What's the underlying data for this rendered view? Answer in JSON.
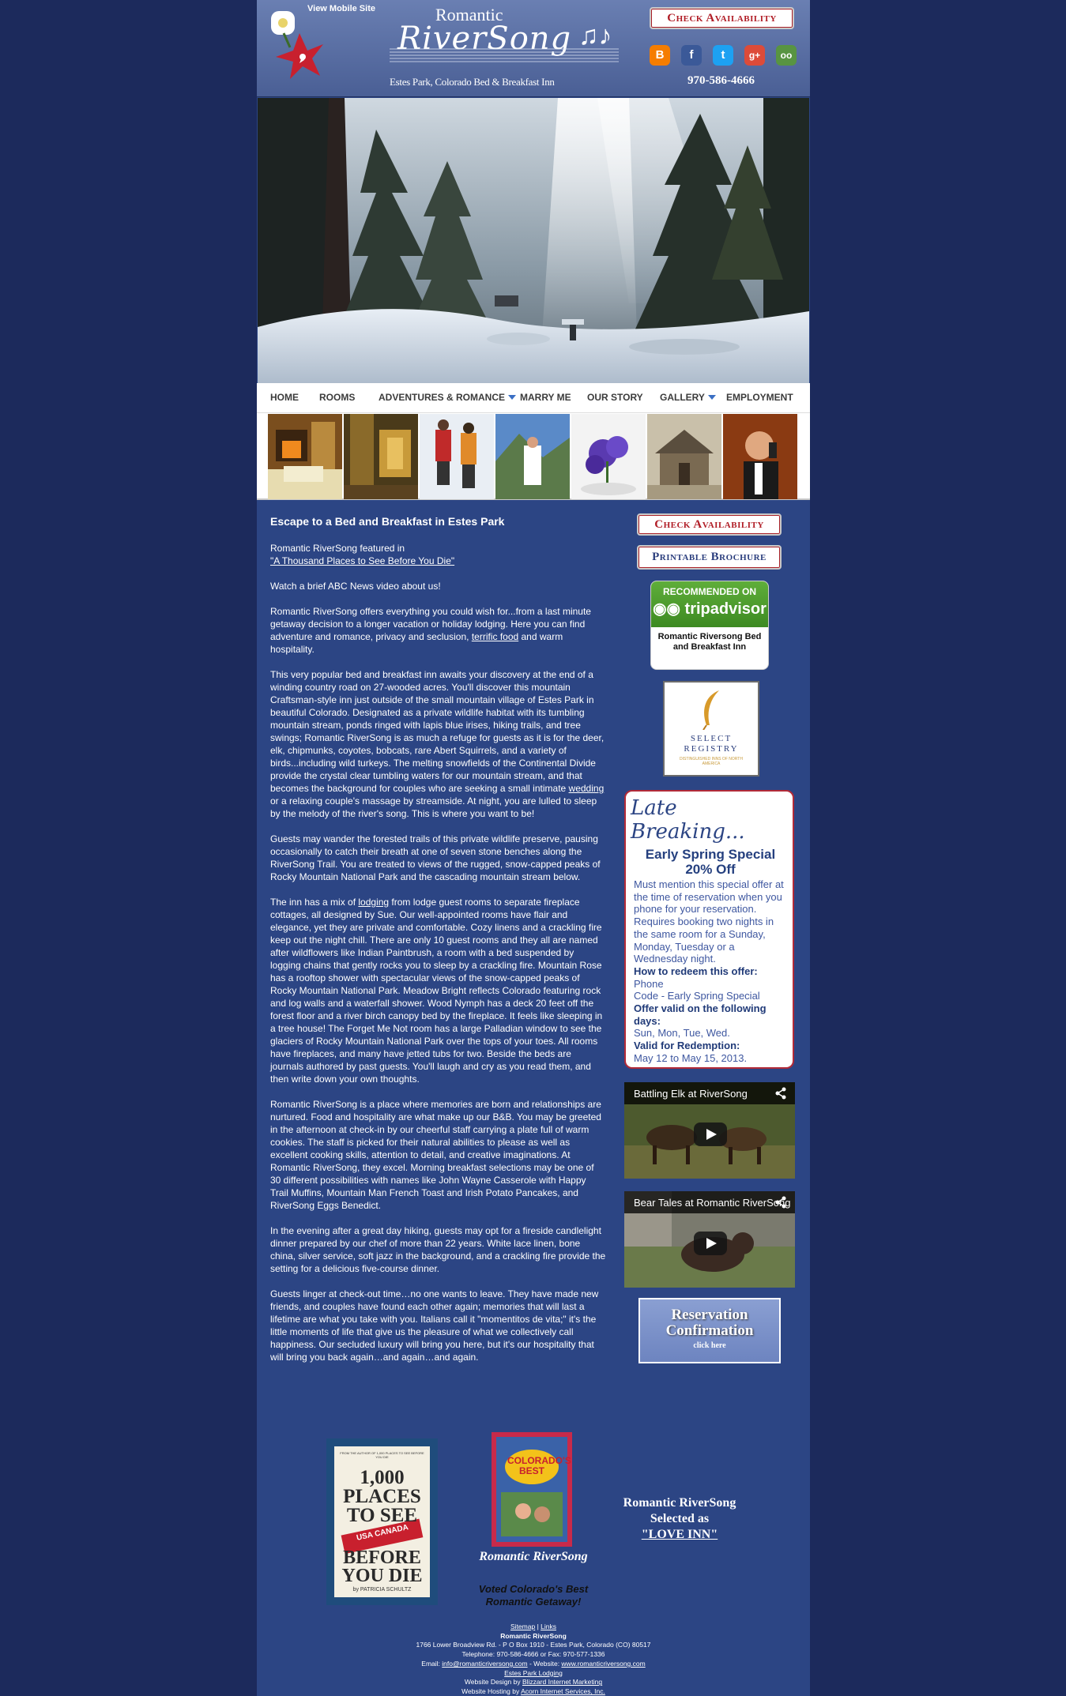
{
  "header": {
    "mobile_link": "View Mobile Site",
    "logo_top": "Romantic",
    "logo_main": "RiverSong",
    "logo_sub": "Estes Park, Colorado Bed & Breakfast Inn",
    "check_availability": "Check Availability",
    "phone": "970-586-4666",
    "socials": [
      {
        "icon": "blogger-icon",
        "glyph": "B",
        "color": "#f57d00"
      },
      {
        "icon": "facebook-icon",
        "glyph": "f",
        "color": "#3b5998"
      },
      {
        "icon": "twitter-icon",
        "glyph": "t",
        "color": "#1da1f2"
      },
      {
        "icon": "google-plus-icon",
        "glyph": "g+",
        "color": "#dd4b39"
      },
      {
        "icon": "tripadvisor-icon",
        "glyph": "oo",
        "color": "#589442"
      }
    ]
  },
  "nav": {
    "home": "HOME",
    "rooms": "ROOMS",
    "adventures": "ADVENTURES & ROMANCE",
    "marry": "MARRY ME",
    "story": "OUR STORY",
    "gallery": "GALLERY",
    "employment": "EMPLOYMENT"
  },
  "main": {
    "heading": "Escape to a Bed and Breakfast in Estes Park",
    "featured_intro": "Romantic RiverSong featured in",
    "featured_link": "\"A Thousand Places to See Before You Die\"",
    "watch_video": "Watch a brief ABC News video about us!",
    "p1_a": "Romantic RiverSong offers everything you could wish for...from a last minute getaway decision to a longer vacation or holiday lodging.  Here you can find adventure and romance, privacy and seclusion, ",
    "p1_link": "terrific food",
    "p1_b": " and warm hospitality.",
    "p2_a": "This very popular bed and breakfast inn awaits your discovery at the end of a winding country road on 27-wooded acres. You'll discover this mountain Craftsman-style inn just outside of the small mountain village of Estes Park in beautiful Colorado. Designated as a private wildlife habitat with its tumbling mountain stream, ponds ringed with lapis blue irises, hiking trails, and tree swings; Romantic RiverSong is as much a refuge for guests as it is for the deer, elk, chipmunks, coyotes, bobcats, rare Abert Squirrels, and a variety of birds...including wild turkeys. The melting snowfields of the Continental Divide provide the crystal clear tumbling waters for our mountain stream, and that becomes the background for couples who are seeking a small intimate ",
    "p2_link": "wedding",
    "p2_b": " or a relaxing couple's massage by streamside. At night, you are lulled to sleep by the melody of the river's song. This is where you want to be!",
    "p3": "Guests may wander the forested trails of this private wildlife preserve, pausing occasionally to catch their breath at one of seven stone benches along the RiverSong Trail. You are treated to views of the rugged, snow-capped peaks of Rocky Mountain National Park and the cascading mountain stream below.",
    "p4_a": "The inn has a mix of ",
    "p4_link": "lodging",
    "p4_b": " from lodge guest rooms to separate fireplace cottages, all designed by Sue. Our well-appointed rooms have flair and elegance, yet they are private and comfortable. Cozy linens and a crackling fire keep out the night chill. There are only 10 guest rooms and they all are named after wildflowers like Indian Paintbrush, a room with a bed suspended by logging chains that gently rocks you to sleep by a crackling fire. Mountain Rose has a rooftop shower with spectacular views of the snow-capped peaks of Rocky Mountain National Park. Meadow Bright reflects Colorado featuring rock and log walls and a waterfall shower. Wood Nymph has a deck 20 feet off the forest floor and a river birch canopy bed by the fireplace. It feels like sleeping in a tree house! The Forget Me Not room has a large Palladian window to see the glaciers of Rocky Mountain National Park over the tops of your toes. All rooms have fireplaces, and many have jetted tubs for two. Beside the beds are journals authored by past guests. You'll laugh and cry as you read them, and then write down your own thoughts.",
    "p5": "Romantic RiverSong is a place where memories are born and relationships are nurtured. Food and hospitality are what make up our B&B. You may be greeted in the afternoon at check-in by our cheerful staff carrying a plate full of warm cookies. The staff is picked for their natural abilities to please as well as excellent cooking skills, attention to detail, and creative imaginations. At Romantic RiverSong, they excel. Morning breakfast selections may be one of 30 different possibilities with names like John Wayne Casserole with Happy Trail Muffins, Mountain Man French Toast and Irish Potato Pancakes, and RiverSong Eggs Benedict.",
    "p6": "In the evening after a great day hiking, guests may opt for a fireside candlelight dinner prepared by our chef of more than 22 years. White lace linen, bone china, silver service, soft jazz in the background, and a crackling fire provide the setting for a delicious five-course dinner.",
    "p7": "Guests linger at check-out time…no one wants to leave. They have made new friends, and couples have found each other again; memories that will last a lifetime are what you take with you. Italians call it \"momentitos de vita;\" it's the little moments of life that give us the pleasure of what we collectively call happiness. Our secluded luxury will bring you here, but it's our hospitality that will bring you back again…and again…and again."
  },
  "sidebar": {
    "check_availability": "Check Availability",
    "printable_brochure": "Printable Brochure",
    "ta_recommended": "RECOMMENDED ON",
    "ta_logo": "tripadvisor",
    "ta_name": "Romantic Riversong Bed and Breakfast Inn",
    "select_registry": "SELECT REGISTRY",
    "select_registry_sub": "DISTINGUISHED INNS OF NORTH AMERICA",
    "late_title": "Late Breaking...",
    "late_special": "Early Spring Special 20% Off",
    "late_mention": "Must mention this special offer at the time of reservation when you phone for your reservation.",
    "late_requires": "Requires booking two nights in the same room for a Sunday, Monday, Tuesday or a Wednesday night.",
    "late_redeem_label": "How to redeem this offer:",
    "late_redeem": "Phone",
    "late_code": "Code - Early Spring Special",
    "late_days_label": "Offer valid on the following days:",
    "late_days": "Sun, Mon, Tue, Wed.",
    "late_valid_label": "Valid for Redemption:",
    "late_valid": "May 12 to May 15, 2013.",
    "video1_title": "Battling Elk at RiverSong",
    "video2_title": "Bear Tales at Romantic RiverSong",
    "res_title": "Reservation Confirmation",
    "res_click": "click here"
  },
  "bottom": {
    "book1_from": "FROM THE AUTHOR OF 1,000 PLACES TO SEE BEFORE YOU DIE",
    "book1_title_a": "1,000",
    "book1_title_b": "PLACES",
    "book1_title_c": "TO SEE",
    "book1_banner": "USA CANADA",
    "book1_title_d": "BEFORE",
    "book1_title_e": "YOU DIE",
    "book1_author": "by PATRICIA SCHULTZ",
    "book2_title": "COLORADO'S BEST",
    "book2_caption": "Romantic RiverSong",
    "book2_vote": "Voted Colorado's Best Romantic Getaway!",
    "love_line1": "Romantic RiverSong",
    "love_line2": "Selected as",
    "love_link": "\"LOVE INN\""
  },
  "footer": {
    "sitemap": "Sitemap",
    "sep": " | ",
    "links": "Links",
    "name": "Romantic RiverSong",
    "address": "1766 Lower Broadview Rd. - P O Box 1910 - Estes Park, Colorado (CO) 80517",
    "telephone": "Telephone: 970-586-4666 or Fax: 970-577-1336",
    "email_label": "Email: ",
    "email": "info@romanticriversong.com",
    "website_label": " - Website: ",
    "website": "www.romanticriversong.com",
    "lodging": "Estes Park Lodging",
    "design_label": "Website Design by ",
    "design": "Blizzard Internet Marketing",
    "hosting_label": "Website Hosting by ",
    "hosting": "Acorn Internet Services, Inc."
  }
}
